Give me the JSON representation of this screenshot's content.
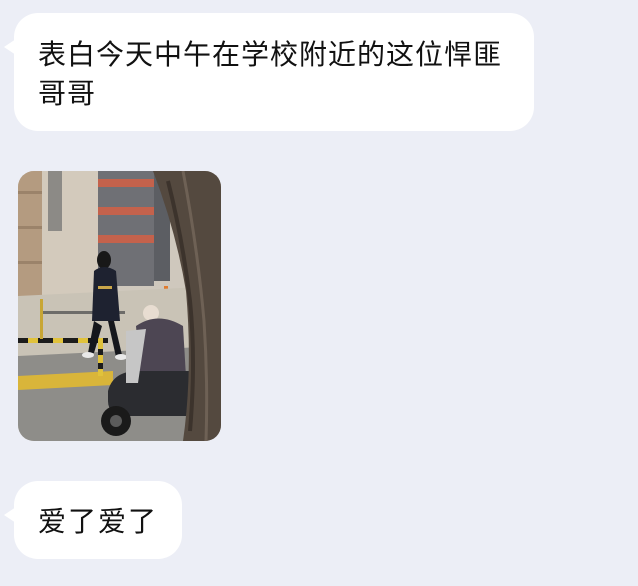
{
  "messages": [
    {
      "id": "msg1",
      "type": "text",
      "text": "表白今天中午在学校附近的这位悍匪哥哥"
    },
    {
      "id": "msg2",
      "type": "image",
      "subject": "photo"
    },
    {
      "id": "msg3",
      "type": "text",
      "text": "爱了爱了"
    }
  ],
  "colors": {
    "background": "#eceef6",
    "bubble": "#ffffff",
    "text": "#111111"
  }
}
